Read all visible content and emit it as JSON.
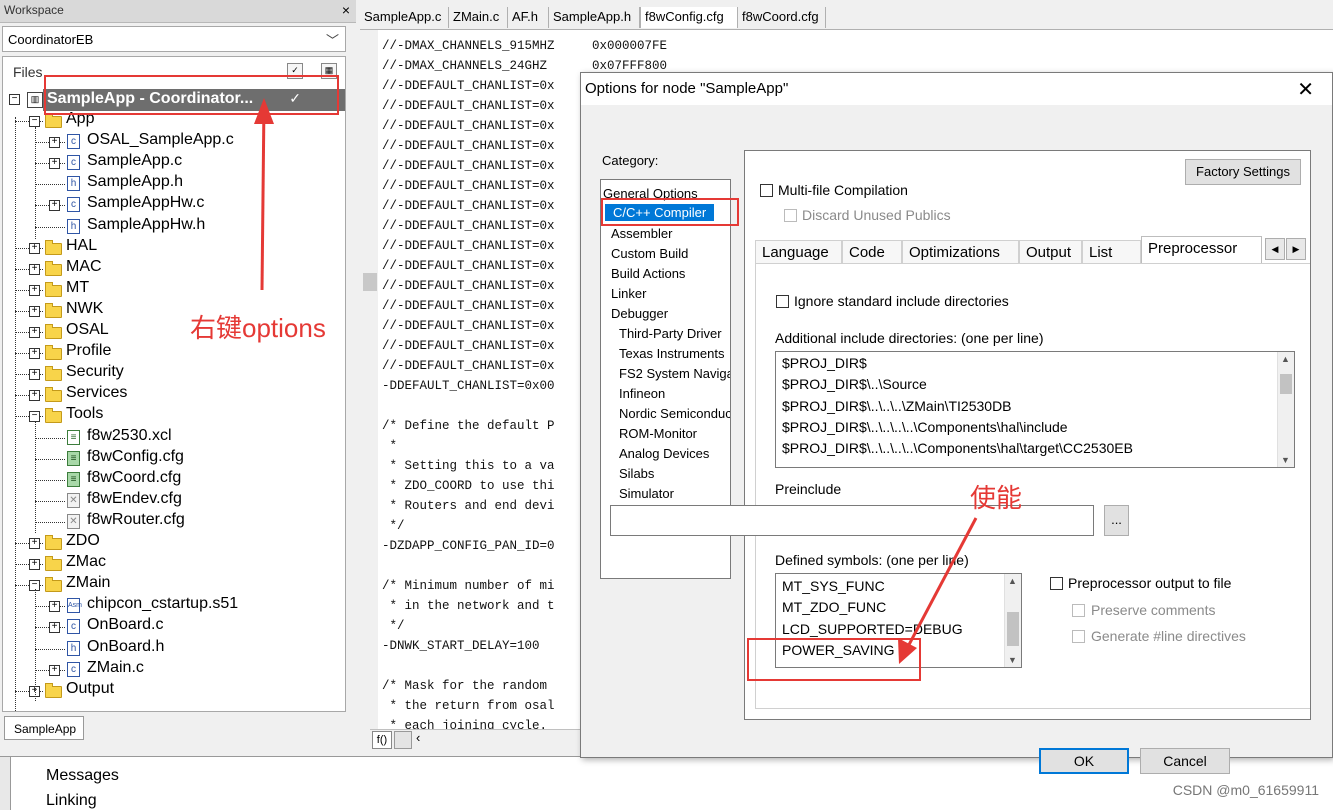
{
  "workspace": {
    "title": "Workspace",
    "close": "×",
    "config": "CoordinatorEB",
    "files_header": "Files",
    "root": "SampleApp - Coordinator...",
    "root_check": "✓",
    "bottom_tab": "SampleApp"
  },
  "tree": [
    {
      "label": "App",
      "kind": "folder",
      "depth": 1,
      "expander": "⊟"
    },
    {
      "label": "OSAL_SampleApp.c",
      "kind": "c",
      "depth": 2,
      "expander": "⊞"
    },
    {
      "label": "SampleApp.c",
      "kind": "c",
      "depth": 2,
      "expander": "⊞"
    },
    {
      "label": "SampleApp.h",
      "kind": "h",
      "depth": 2,
      "expander": ""
    },
    {
      "label": "SampleAppHw.c",
      "kind": "c",
      "depth": 2,
      "expander": "⊞"
    },
    {
      "label": "SampleAppHw.h",
      "kind": "h",
      "depth": 2,
      "expander": ""
    },
    {
      "label": "HAL",
      "kind": "folder",
      "depth": 1,
      "expander": "⊞"
    },
    {
      "label": "MAC",
      "kind": "folder",
      "depth": 1,
      "expander": "⊞"
    },
    {
      "label": "MT",
      "kind": "folder",
      "depth": 1,
      "expander": "⊞"
    },
    {
      "label": "NWK",
      "kind": "folder",
      "depth": 1,
      "expander": "⊞"
    },
    {
      "label": "OSAL",
      "kind": "folder",
      "depth": 1,
      "expander": "⊞"
    },
    {
      "label": "Profile",
      "kind": "folder",
      "depth": 1,
      "expander": "⊞"
    },
    {
      "label": "Security",
      "kind": "folder",
      "depth": 1,
      "expander": "⊞"
    },
    {
      "label": "Services",
      "kind": "folder",
      "depth": 1,
      "expander": "⊞"
    },
    {
      "label": "Tools",
      "kind": "folder",
      "depth": 1,
      "expander": "⊟"
    },
    {
      "label": "f8w2530.xcl",
      "kind": "xcl",
      "depth": 2,
      "expander": ""
    },
    {
      "label": "f8wConfig.cfg",
      "kind": "cfg",
      "depth": 2,
      "expander": ""
    },
    {
      "label": "f8wCoord.cfg",
      "kind": "cfg",
      "depth": 2,
      "expander": ""
    },
    {
      "label": "f8wEndev.cfg",
      "kind": "x",
      "depth": 2,
      "expander": ""
    },
    {
      "label": "f8wRouter.cfg",
      "kind": "x",
      "depth": 2,
      "expander": ""
    },
    {
      "label": "ZDO",
      "kind": "folder",
      "depth": 1,
      "expander": "⊞"
    },
    {
      "label": "ZMac",
      "kind": "folder",
      "depth": 1,
      "expander": "⊞"
    },
    {
      "label": "ZMain",
      "kind": "folder",
      "depth": 1,
      "expander": "⊟"
    },
    {
      "label": "chipcon_cstartup.s51",
      "kind": "asm",
      "depth": 2,
      "expander": "⊞"
    },
    {
      "label": "OnBoard.c",
      "kind": "c",
      "depth": 2,
      "expander": "⊞"
    },
    {
      "label": "OnBoard.h",
      "kind": "h",
      "depth": 2,
      "expander": ""
    },
    {
      "label": "ZMain.c",
      "kind": "c",
      "depth": 2,
      "expander": "⊞"
    },
    {
      "label": "Output",
      "kind": "folder",
      "depth": 1,
      "expander": "⊞"
    }
  ],
  "editor": {
    "tabs": [
      "SampleApp.c",
      "ZMain.c",
      "AF.h",
      "SampleApp.h",
      "f8wConfig.cfg",
      "f8wCoord.cfg"
    ],
    "active_tab": 4,
    "lines": [
      "//-DMAX_CHANNELS_915MHZ     0x000007FE",
      "//-DMAX_CHANNELS_24GHZ      0x07FFF800",
      "//-DDEFAULT_CHANLIST=0x",
      "//-DDEFAULT_CHANLIST=0x",
      "//-DDEFAULT_CHANLIST=0x",
      "//-DDEFAULT_CHANLIST=0x",
      "//-DDEFAULT_CHANLIST=0x",
      "//-DDEFAULT_CHANLIST=0x",
      "//-DDEFAULT_CHANLIST=0x",
      "//-DDEFAULT_CHANLIST=0x",
      "//-DDEFAULT_CHANLIST=0x",
      "//-DDEFAULT_CHANLIST=0x",
      "//-DDEFAULT_CHANLIST=0x",
      "//-DDEFAULT_CHANLIST=0x",
      "//-DDEFAULT_CHANLIST=0x",
      "//-DDEFAULT_CHANLIST=0x",
      "//-DDEFAULT_CHANLIST=0x",
      "-DDEFAULT_CHANLIST=0x00",
      "",
      "/* Define the default P",
      " *",
      " * Setting this to a va",
      " * ZDO_COORD to use thi",
      " * Routers and end devi",
      " */",
      "-DZDAPP_CONFIG_PAN_ID=0",
      "",
      "/* Minimum number of mi",
      " * in the network and t",
      " */",
      "-DNWK_START_DELAY=100",
      "",
      "/* Mask for the random",
      " * the return from osal",
      " * each joining cycle."
    ],
    "bottom_fo": "f()",
    "bottom_left": "‹"
  },
  "messages": {
    "header": "Messages",
    "row1": "Linking"
  },
  "dialog": {
    "title": "Options for node \"SampleApp\"",
    "close": "✕",
    "category_label": "Category:",
    "categories": [
      {
        "label": "General Options",
        "indent": 0
      },
      {
        "label": "C/C++ Compiler",
        "indent": 0,
        "selected": true
      },
      {
        "label": "Assembler",
        "indent": 1
      },
      {
        "label": "Custom Build",
        "indent": 1
      },
      {
        "label": "Build Actions",
        "indent": 1
      },
      {
        "label": "Linker",
        "indent": 1
      },
      {
        "label": "Debugger",
        "indent": 1
      },
      {
        "label": "Third-Party Driver",
        "indent": 2
      },
      {
        "label": "Texas Instruments",
        "indent": 2
      },
      {
        "label": "FS2 System Navigator",
        "indent": 2
      },
      {
        "label": "Infineon",
        "indent": 2
      },
      {
        "label": "Nordic Semiconductor",
        "indent": 2
      },
      {
        "label": "ROM-Monitor",
        "indent": 2
      },
      {
        "label": "Analog Devices",
        "indent": 2
      },
      {
        "label": "Silabs",
        "indent": 2
      },
      {
        "label": "Simulator",
        "indent": 2
      }
    ],
    "factory_settings": "Factory Settings",
    "multi_file": "Multi-file Compilation",
    "discard_unused": "Discard Unused Publics",
    "tabs": [
      "Language",
      "Code",
      "Optimizations",
      "Output",
      "List",
      "Preprocessor"
    ],
    "active_tab": 5,
    "ignore_std": "Ignore standard include directories",
    "additional_label": "Additional include directories: (one per line)",
    "include_dirs": [
      "$PROJ_DIR$",
      "$PROJ_DIR$\\..\\Source",
      "$PROJ_DIR$\\..\\..\\..\\ZMain\\TI2530DB",
      "$PROJ_DIR$\\..\\..\\..\\..\\Components\\hal\\include",
      "$PROJ_DIR$\\..\\..\\..\\..\\Components\\hal\\target\\CC2530EB"
    ],
    "preinclude_label": "Preinclude",
    "preinclude_value": "",
    "browse": "...",
    "defined_label": "Defined symbols: (one per line)",
    "defined_symbols": [
      "MT_SYS_FUNC",
      "MT_ZDO_FUNC",
      "LCD_SUPPORTED=DEBUG",
      "POWER_SAVING"
    ],
    "pp_output": "Preprocessor output to file",
    "preserve_comments": "Preserve comments",
    "generate_line": "Generate #line directives",
    "ok": "OK",
    "cancel": "Cancel"
  },
  "annotations": {
    "right_click": "右键options",
    "enable": "使能",
    "color": "#e53935"
  },
  "watermark": "CSDN @m0_61659911"
}
